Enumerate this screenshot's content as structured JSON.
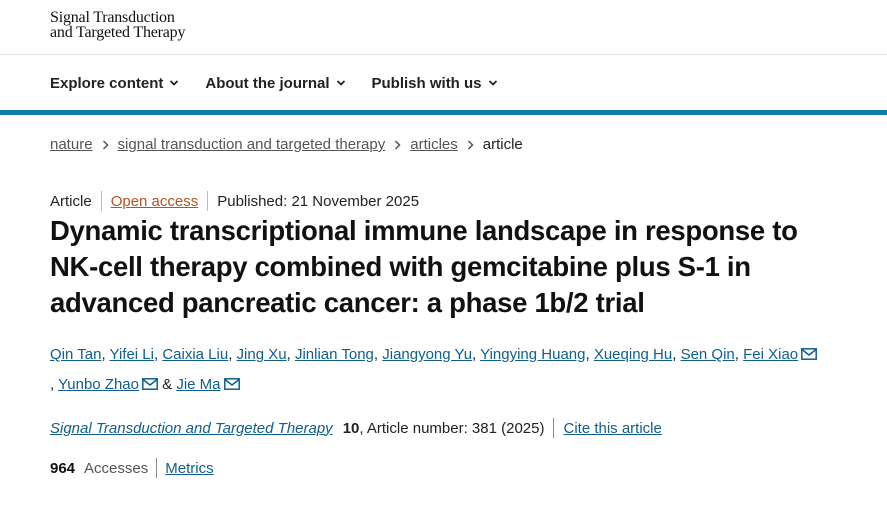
{
  "header": {
    "logo_line1": "Signal Transduction",
    "logo_line2": "and Targeted Therapy"
  },
  "nav": {
    "items": [
      {
        "label": "Explore content"
      },
      {
        "label": "About the journal"
      },
      {
        "label": "Publish with us"
      }
    ]
  },
  "breadcrumb": {
    "items": [
      "nature",
      "signal transduction and targeted therapy",
      "articles"
    ],
    "current": "article"
  },
  "meta": {
    "type": "Article",
    "access": "Open access",
    "published": "Published: 21 November 2025"
  },
  "article": {
    "title": "Dynamic transcriptional immune landscape in response to NK-cell therapy combined with gemcitabine plus S-1 in advanced pancreatic cancer: a phase 1b/2 trial"
  },
  "authors": [
    "Qin Tan",
    "Yifei Li",
    "Caixia Liu",
    "Jing Xu",
    "Jinlian Tong",
    "Jiangyong Yu",
    "Yingying Huang",
    "Xueqing Hu",
    "Sen Qin",
    "Fei Xiao",
    "Yunbo Zhao",
    "Jie Ma"
  ],
  "authors_conjunction": "&",
  "citation": {
    "journal": "Signal Transduction and Targeted Therapy",
    "volume": "10",
    "article_number": ", Article number: 381 (2025)",
    "cite_label": "Cite this article"
  },
  "metrics": {
    "accesses_count": "964",
    "accesses_label": "Accesses",
    "metrics_label": "Metrics"
  },
  "colors": {
    "accent_bar": "#0f7ea5",
    "link": "#0f5f8a",
    "open_access": "#b3541e"
  }
}
